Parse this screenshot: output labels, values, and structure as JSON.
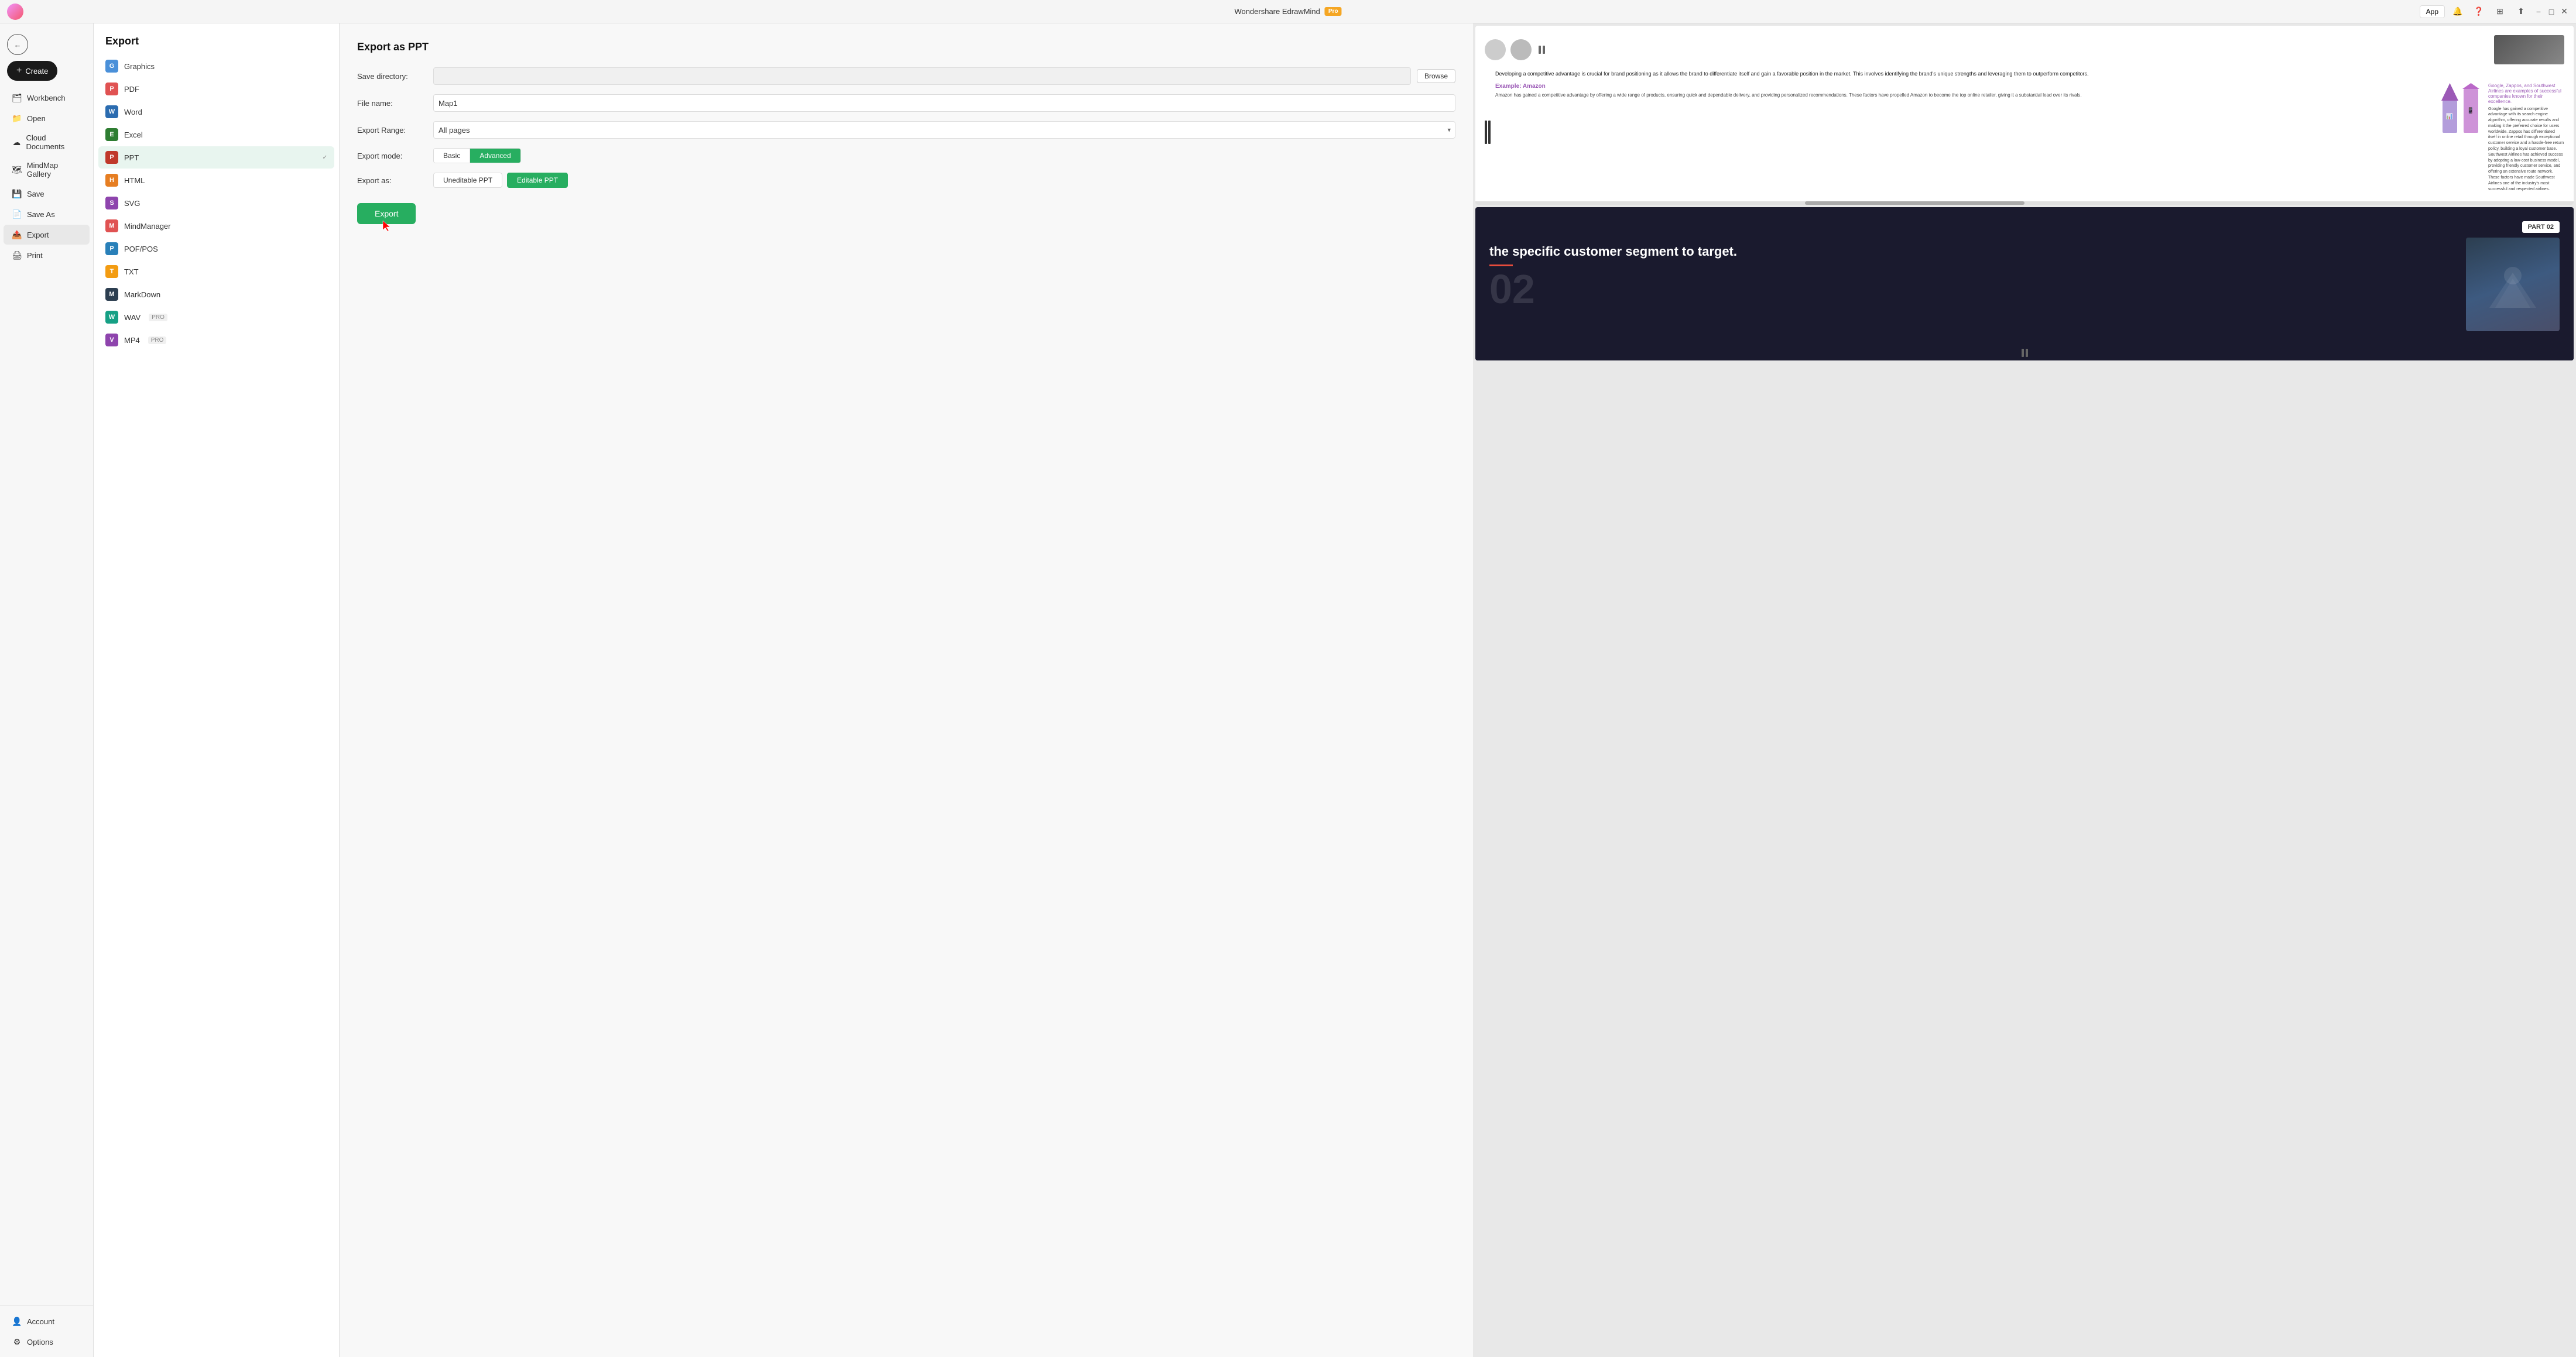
{
  "titlebar": {
    "title": "Wondershare EdrawMind",
    "pro_label": "Pro",
    "app_btn": "App",
    "minimize": "−",
    "maximize": "□",
    "close": "✕"
  },
  "sidebar": {
    "back_btn": "←",
    "create_btn": "Create",
    "items": [
      {
        "id": "workbench",
        "label": "Workbench",
        "icon": "🗂"
      },
      {
        "id": "open",
        "label": "Open",
        "icon": "📁"
      },
      {
        "id": "cloud",
        "label": "Cloud Documents",
        "icon": "☁"
      },
      {
        "id": "mindmap",
        "label": "MindMap Gallery",
        "icon": "🗺"
      },
      {
        "id": "save",
        "label": "Save",
        "icon": "💾"
      },
      {
        "id": "saveas",
        "label": "Save As",
        "icon": "📄"
      },
      {
        "id": "export",
        "label": "Export",
        "icon": "📤"
      },
      {
        "id": "print",
        "label": "Print",
        "icon": "🖨"
      }
    ],
    "bottom_items": [
      {
        "id": "account",
        "label": "Account",
        "icon": "👤"
      },
      {
        "id": "options",
        "label": "Options",
        "icon": "⚙"
      }
    ]
  },
  "export_panel": {
    "title": "Export",
    "formats": [
      {
        "id": "graphics",
        "label": "Graphics",
        "icon": "G",
        "color": "fi-graphics"
      },
      {
        "id": "pdf",
        "label": "PDF",
        "icon": "P",
        "color": "fi-pdf"
      },
      {
        "id": "word",
        "label": "Word",
        "icon": "W",
        "color": "fi-word"
      },
      {
        "id": "excel",
        "label": "Excel",
        "icon": "E",
        "color": "fi-excel"
      },
      {
        "id": "ppt",
        "label": "PPT",
        "icon": "P",
        "color": "fi-ppt",
        "active": true
      },
      {
        "id": "html",
        "label": "HTML",
        "icon": "H",
        "color": "fi-html"
      },
      {
        "id": "svg",
        "label": "SVG",
        "icon": "S",
        "color": "fi-svg"
      },
      {
        "id": "mindmanager",
        "label": "MindManager",
        "icon": "M",
        "color": "fi-mindmanager"
      },
      {
        "id": "pofpos",
        "label": "POF/POS",
        "icon": "P",
        "color": "fi-pofpos"
      },
      {
        "id": "txt",
        "label": "TXT",
        "icon": "T",
        "color": "fi-txt"
      },
      {
        "id": "markdown",
        "label": "MarkDown",
        "icon": "M",
        "color": "fi-markdown"
      },
      {
        "id": "wav",
        "label": "WAV",
        "icon": "W",
        "color": "fi-wav",
        "pro": true
      },
      {
        "id": "mp4",
        "label": "MP4",
        "icon": "V",
        "color": "fi-mp4",
        "pro": true
      }
    ]
  },
  "export_form": {
    "title": "Export as PPT",
    "save_dir_label": "Save directory:",
    "save_dir_placeholder": "",
    "browse_label": "Browse",
    "file_name_label": "File name:",
    "file_name_value": "Map1",
    "export_range_label": "Export Range:",
    "export_range_value": "All pages",
    "export_mode_label": "Export mode:",
    "mode_basic": "Basic",
    "mode_advanced": "Advanced",
    "export_as_label": "Export as:",
    "type_uneditable": "Uneditable PPT",
    "type_editable": "Editable PPT",
    "export_btn": "Export"
  },
  "preview": {
    "slide1": {
      "heading": "Developing a competitive advantage is crucial for brand positioning as it allows the brand to differentiate itself and gain a favorable position in the market. This involves identifying the brand's unique strengths and leveraging them to outperform competitors.",
      "example_amazon": "Example: Amazon",
      "amazon_text": "Amazon has gained a competitive advantage by offering a wide range of products, ensuring quick and dependable delivery, and providing personalized recommendations. These factors have propelled Amazon to become the top online retailer, giving it a substantial lead over its rivals.",
      "right_text": "Google, Zappos, and Southwest Airlines are examples of successful companies known for their excellence.",
      "right_body": "Google has gained a competitive advantage with its search engine algorithm, offering accurate results and making it the preferred choice for users worldwide. Zappos has differentiated itself in online retail through exceptional customer service and a hassle-free return policy, building a loyal customer base. Southwest Airlines has achieved success by adopting a low-cost business model, providing friendly customer service, and offering an extensive route network. These factors have made Southwest Airlines one of the industry's most successful and respected airlines."
    },
    "slide2": {
      "text": "the specific customer segment to target.",
      "part_label": "PART 02",
      "number": "02"
    }
  }
}
